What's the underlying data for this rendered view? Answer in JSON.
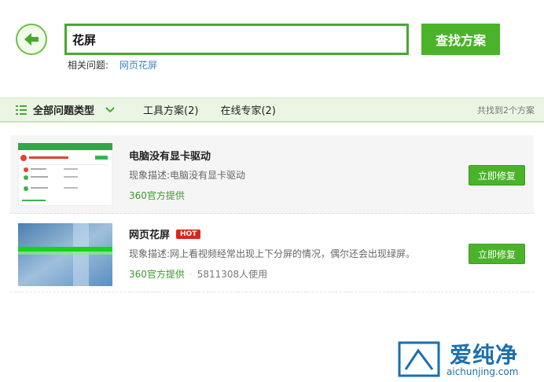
{
  "search": {
    "query": "花屏",
    "button_label": "查找方案"
  },
  "related": {
    "label": "相关问题:",
    "link": "网页花屏"
  },
  "filter": {
    "all_types": "全部问题类型",
    "tab_tools": "工具方案(2)",
    "tab_experts": "在线专家(2)",
    "count": "共找到2个方案"
  },
  "results": [
    {
      "title": "电脑没有显卡驱动",
      "desc_label": "现象描述:",
      "desc": "电脑没有显卡驱动",
      "provider": "360官方提供",
      "fix_label": "立即修复"
    },
    {
      "title": "网页花屏",
      "badge": "HOT",
      "desc_label": "现象描述:",
      "desc": "网上看视频经常出现上下分屏的情况，偶尔还会出现绿屏。",
      "provider": "360官方提供",
      "users": "5811308人使用",
      "fix_label": "立即修复"
    }
  ],
  "watermark": {
    "brand": "爱纯净",
    "url": "aichunjing.com"
  },
  "colors": {
    "accent": "#4ab32a",
    "link": "#3a87c8",
    "hot": "#d9261c"
  }
}
